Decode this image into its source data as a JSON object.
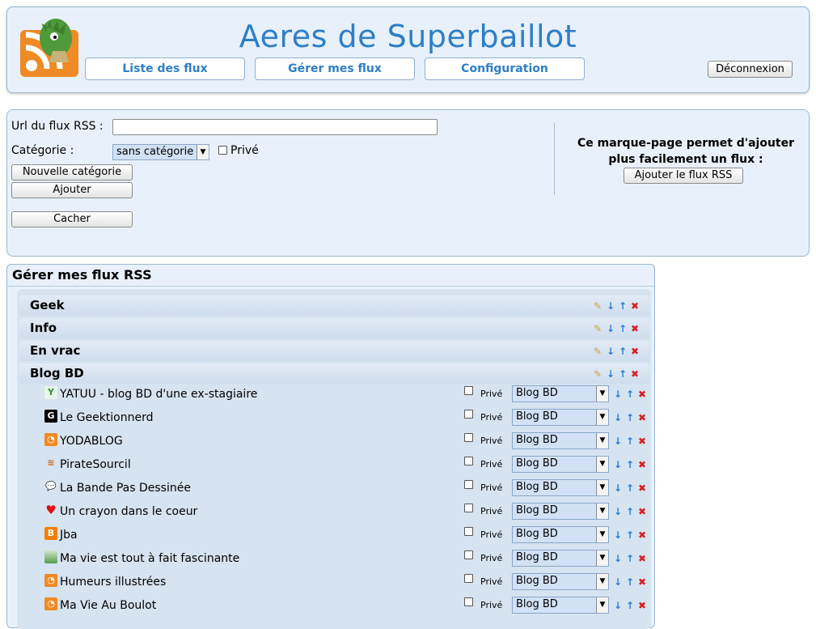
{
  "header": {
    "title": "Aeres de Superbaillot",
    "nav": [
      "Liste des flux",
      "Gérer mes flux",
      "Configuration"
    ],
    "logout": "Déconnexion"
  },
  "form": {
    "url_label": "Url du flux RSS :",
    "url_value": "",
    "category_label": "Catégorie :",
    "category_selected": "sans catégorie",
    "private_label": "Privé",
    "new_category_btn": "Nouvelle catégorie",
    "add_btn": "Ajouter",
    "hide_btn": "Cacher",
    "bookmark_text": "Ce marque-page permet d'ajouter plus facilement un flux :",
    "bookmark_btn": "Ajouter le flux RSS"
  },
  "manage": {
    "title": "Gérer mes flux RSS",
    "categories": [
      "Geek",
      "Info",
      "En vrac",
      "Blog BD"
    ],
    "private_label": "Privé",
    "feeds": [
      {
        "name": "YATUU - blog BD d'une ex-stagiaire",
        "category": "Blog BD",
        "icon": "yatuu-icon"
      },
      {
        "name": "Le Geektionnerd",
        "category": "Blog BD",
        "icon": "geektionnerd-icon"
      },
      {
        "name": "YODABLOG",
        "category": "Blog BD",
        "icon": "rss-icon"
      },
      {
        "name": "PirateSourcil",
        "category": "Blog BD",
        "icon": "piratesourcil-icon"
      },
      {
        "name": "La Bande Pas Dessinée",
        "category": "Blog BD",
        "icon": "speech-bubble-icon"
      },
      {
        "name": "Un crayon dans le coeur",
        "category": "Blog BD",
        "icon": "heart-icon"
      },
      {
        "name": "Jba",
        "category": "Blog BD",
        "icon": "blogger-icon"
      },
      {
        "name": "Ma vie est tout à fait fascinante",
        "category": "Blog BD",
        "icon": "landscape-icon"
      },
      {
        "name": "Humeurs illustrées",
        "category": "Blog BD",
        "icon": "rss-icon"
      },
      {
        "name": "Ma Vie Au Boulot",
        "category": "Blog BD",
        "icon": "rss-icon"
      }
    ]
  },
  "colors": {
    "title": "#2e7fc6",
    "panel_bg": "#e8f1fb",
    "select_bg": "#d2e1f5",
    "delete": "#d82020",
    "move": "#2a7cd1"
  }
}
